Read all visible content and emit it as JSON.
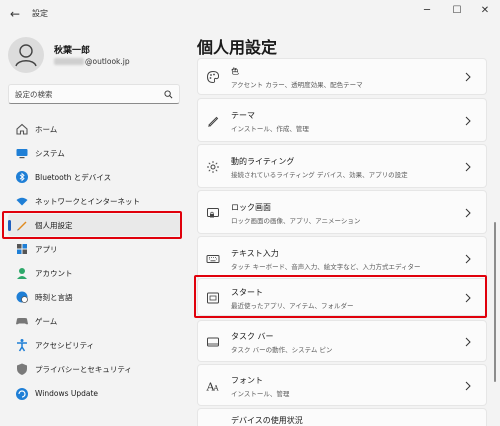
{
  "window": {
    "title": "設定"
  },
  "user": {
    "name": "秋葉一郎",
    "email_suffix": "@outlook.jp"
  },
  "search": {
    "placeholder": "設定の検索"
  },
  "sidebar": {
    "items": [
      {
        "label": "ホーム",
        "icon": "home-icon"
      },
      {
        "label": "システム",
        "icon": "system-monitor-icon"
      },
      {
        "label": "Bluetooth とデバイス",
        "icon": "bluetooth-icon"
      },
      {
        "label": "ネットワークとインターネット",
        "icon": "wifi-icon"
      },
      {
        "label": "個人用設定",
        "icon": "pen-brush-icon",
        "active": true
      },
      {
        "label": "アプリ",
        "icon": "apps-icon"
      },
      {
        "label": "アカウント",
        "icon": "account-icon"
      },
      {
        "label": "時刻と言語",
        "icon": "globe-clock-icon"
      },
      {
        "label": "ゲーム",
        "icon": "gamepad-icon"
      },
      {
        "label": "アクセシビリティ",
        "icon": "accessibility-icon"
      },
      {
        "label": "プライバシーとセキュリティ",
        "icon": "shield-icon"
      },
      {
        "label": "Windows Update",
        "icon": "windows-update-icon"
      }
    ]
  },
  "main": {
    "title": "個人用設定",
    "cards": [
      {
        "title": "色",
        "desc": "アクセント カラー、透明度効果、配色テーマ",
        "icon": "palette-icon"
      },
      {
        "title": "テーマ",
        "desc": "インストール、作成、管理",
        "icon": "brush-icon"
      },
      {
        "title": "動的ライティング",
        "desc": "接続されているライティング デバイス、効果、アプリの設定",
        "icon": "lighting-icon"
      },
      {
        "title": "ロック画面",
        "desc": "ロック画面の画像、アプリ、アニメーション",
        "icon": "lock-screen-icon"
      },
      {
        "title": "テキスト入力",
        "desc": "タッチ キーボード、音声入力、絵文字など、入力方式エディター",
        "icon": "keyboard-icon"
      },
      {
        "title": "スタート",
        "desc": "最近使ったアプリ、アイテム、フォルダー",
        "icon": "start-menu-icon"
      },
      {
        "title": "タスク バー",
        "desc": "タスク バーの動作、システム ピン",
        "icon": "taskbar-icon"
      },
      {
        "title": "フォント",
        "desc": "インストール、管理",
        "icon": "font-icon"
      },
      {
        "title": "デバイスの使用状況",
        "desc": "",
        "icon": "device-usage-icon"
      }
    ]
  },
  "colors": {
    "highlight_red": "#e0000b",
    "accent": "#1f5fbf"
  }
}
